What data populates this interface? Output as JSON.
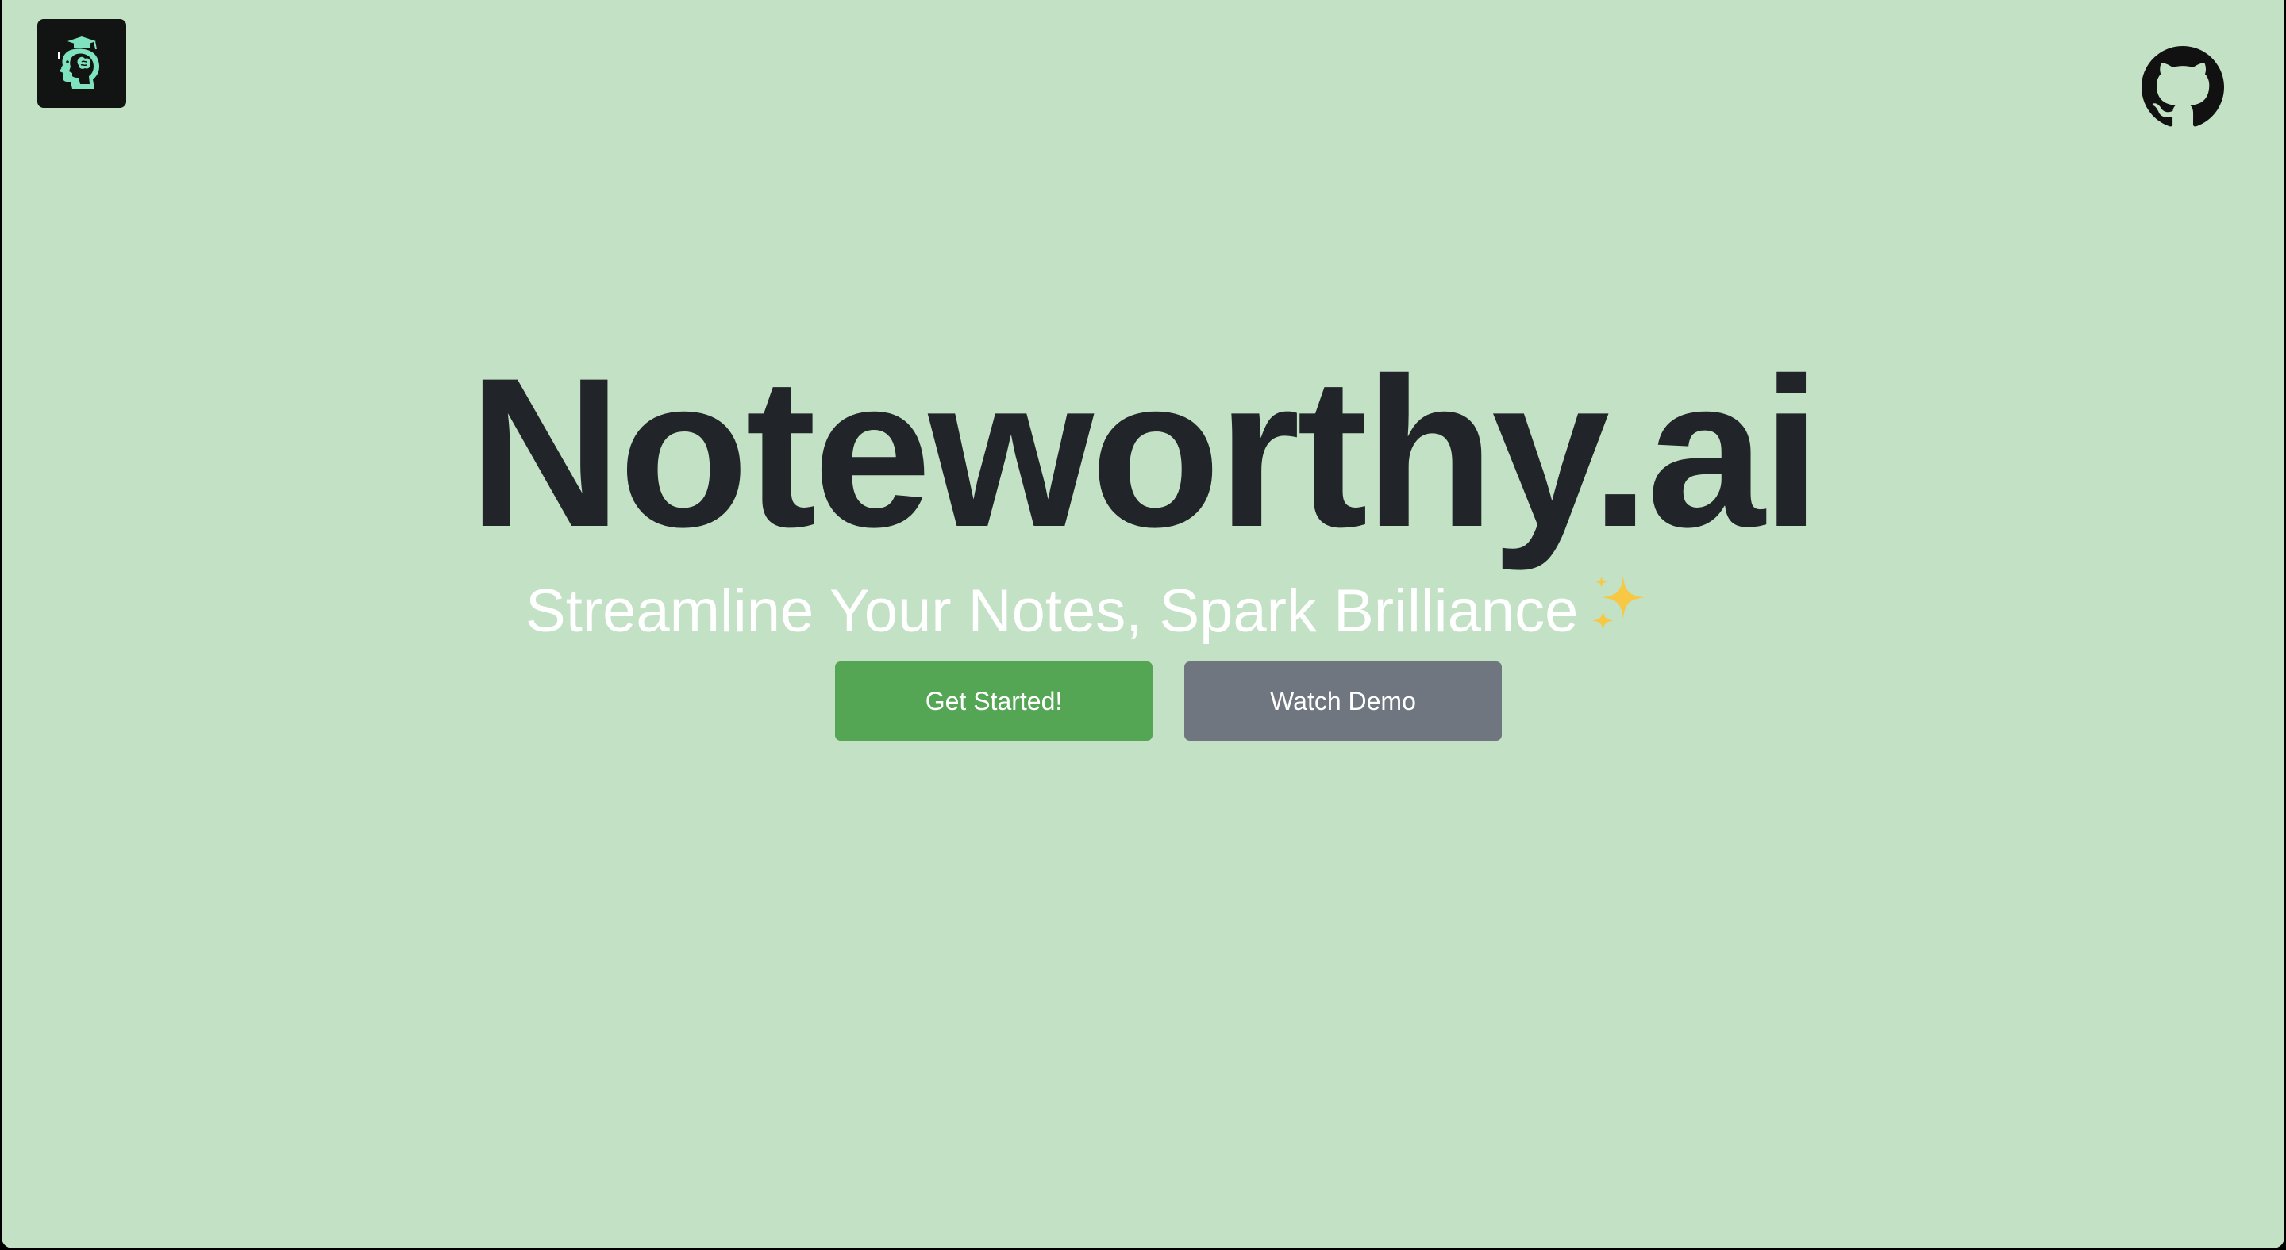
{
  "header": {
    "logo_icon": "graduate-head-brain-icon",
    "github_icon": "github-icon"
  },
  "hero": {
    "title": "Noteworthy.ai",
    "tagline": "Streamline Your Notes, Spark Brilliance",
    "tagline_emoji_icon": "sparkles-icon"
  },
  "actions": {
    "primary_label": "Get Started!",
    "secondary_label": "Watch Demo"
  },
  "colors": {
    "background": "#c3e1c5",
    "title_text": "#212529",
    "tagline_text": "#ffffff",
    "primary_button": "#54a554",
    "secondary_button": "#6f767f",
    "logo_background": "#111412",
    "logo_accent": "#7fe3c0"
  }
}
